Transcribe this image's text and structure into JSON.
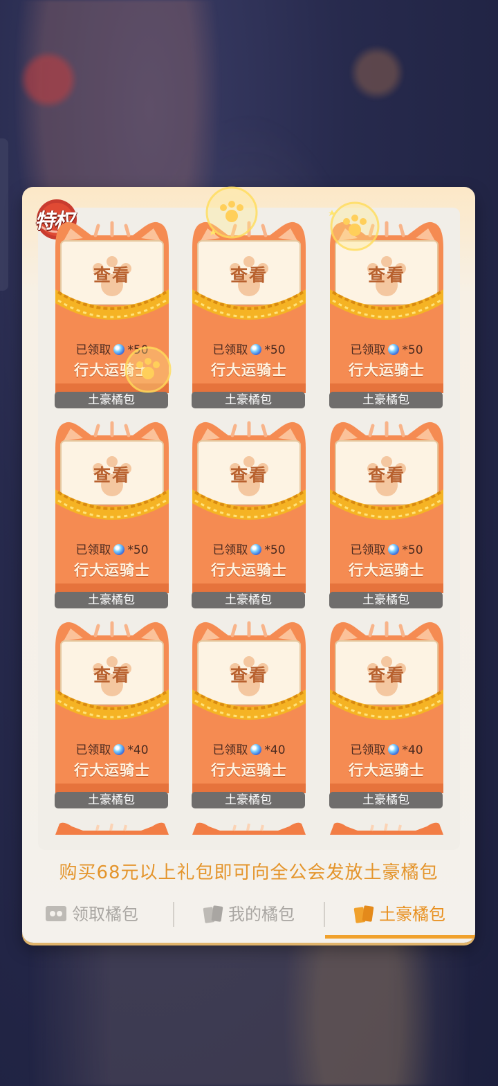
{
  "badge": {
    "label": "特权"
  },
  "cards": [
    {
      "view": "查看",
      "claimed_label": "已领取",
      "amount": "*50",
      "sender": "行大运骑士",
      "pack_name": "土豪橘包"
    },
    {
      "view": "查看",
      "claimed_label": "已领取",
      "amount": "*50",
      "sender": "行大运骑士",
      "pack_name": "土豪橘包"
    },
    {
      "view": "查看",
      "claimed_label": "已领取",
      "amount": "*50",
      "sender": "行大运骑士",
      "pack_name": "土豪橘包"
    },
    {
      "view": "查看",
      "claimed_label": "已领取",
      "amount": "*50",
      "sender": "行大运骑士",
      "pack_name": "土豪橘包"
    },
    {
      "view": "查看",
      "claimed_label": "已领取",
      "amount": "*50",
      "sender": "行大运骑士",
      "pack_name": "土豪橘包"
    },
    {
      "view": "查看",
      "claimed_label": "已领取",
      "amount": "*50",
      "sender": "行大运骑士",
      "pack_name": "土豪橘包"
    },
    {
      "view": "查看",
      "claimed_label": "已领取",
      "amount": "*40",
      "sender": "行大运骑士",
      "pack_name": "土豪橘包"
    },
    {
      "view": "查看",
      "claimed_label": "已领取",
      "amount": "*40",
      "sender": "行大运骑士",
      "pack_name": "土豪橘包"
    },
    {
      "view": "查看",
      "claimed_label": "已领取",
      "amount": "*40",
      "sender": "行大运骑士",
      "pack_name": "土豪橘包"
    }
  ],
  "notice": "购买68元以上礼包即可向全公会发放土豪橘包",
  "tabs": [
    {
      "label": "领取橘包",
      "icon": "envelope-icon",
      "active": false
    },
    {
      "label": "我的橘包",
      "icon": "packs-icon",
      "active": false
    },
    {
      "label": "土豪橘包",
      "icon": "packs-icon",
      "active": true
    }
  ],
  "colors": {
    "accent": "#e8901f",
    "card_orange": "#f58b52",
    "label_gray": "#6f6d6c",
    "notice": "#e4952c"
  }
}
